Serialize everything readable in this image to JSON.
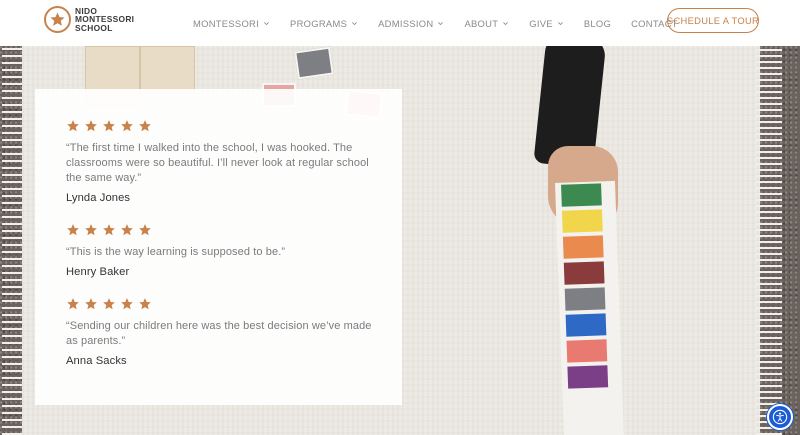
{
  "logo": {
    "lines": [
      "NIDO",
      "MONTESSORI",
      "SCHOOL"
    ],
    "icon": "star-logo-icon"
  },
  "nav": {
    "items": [
      {
        "label": "MONTESSORI",
        "has_dropdown": true
      },
      {
        "label": "PROGRAMS",
        "has_dropdown": true
      },
      {
        "label": "ADMISSION",
        "has_dropdown": true
      },
      {
        "label": "ABOUT",
        "has_dropdown": true
      },
      {
        "label": "GIVE",
        "has_dropdown": true
      },
      {
        "label": "BLOG",
        "has_dropdown": false
      },
      {
        "label": "CONTACT",
        "has_dropdown": false
      }
    ],
    "cta_label": "SCHEDULE A TOUR"
  },
  "testimonials": [
    {
      "rating": 5,
      "quote": "“The first time I walked into the school, I was hooked. The classrooms were so beautiful. I’ll never look at regular school the same way.”",
      "author": "Lynda Jones"
    },
    {
      "rating": 5,
      "quote": "“This is the way learning is supposed to be.”",
      "author": "Henry Baker"
    },
    {
      "rating": 5,
      "quote": "“Sending our children here was the best decision we’ve made as parents.”",
      "author": "Anna Sacks"
    }
  ],
  "colors": {
    "accent": "#c8824a",
    "star": "#c8824a",
    "a11y": "#1a5bd6"
  },
  "icons": {
    "star": "star-icon",
    "dropdown": "chevron-down-icon",
    "accessibility": "accessibility-icon"
  }
}
